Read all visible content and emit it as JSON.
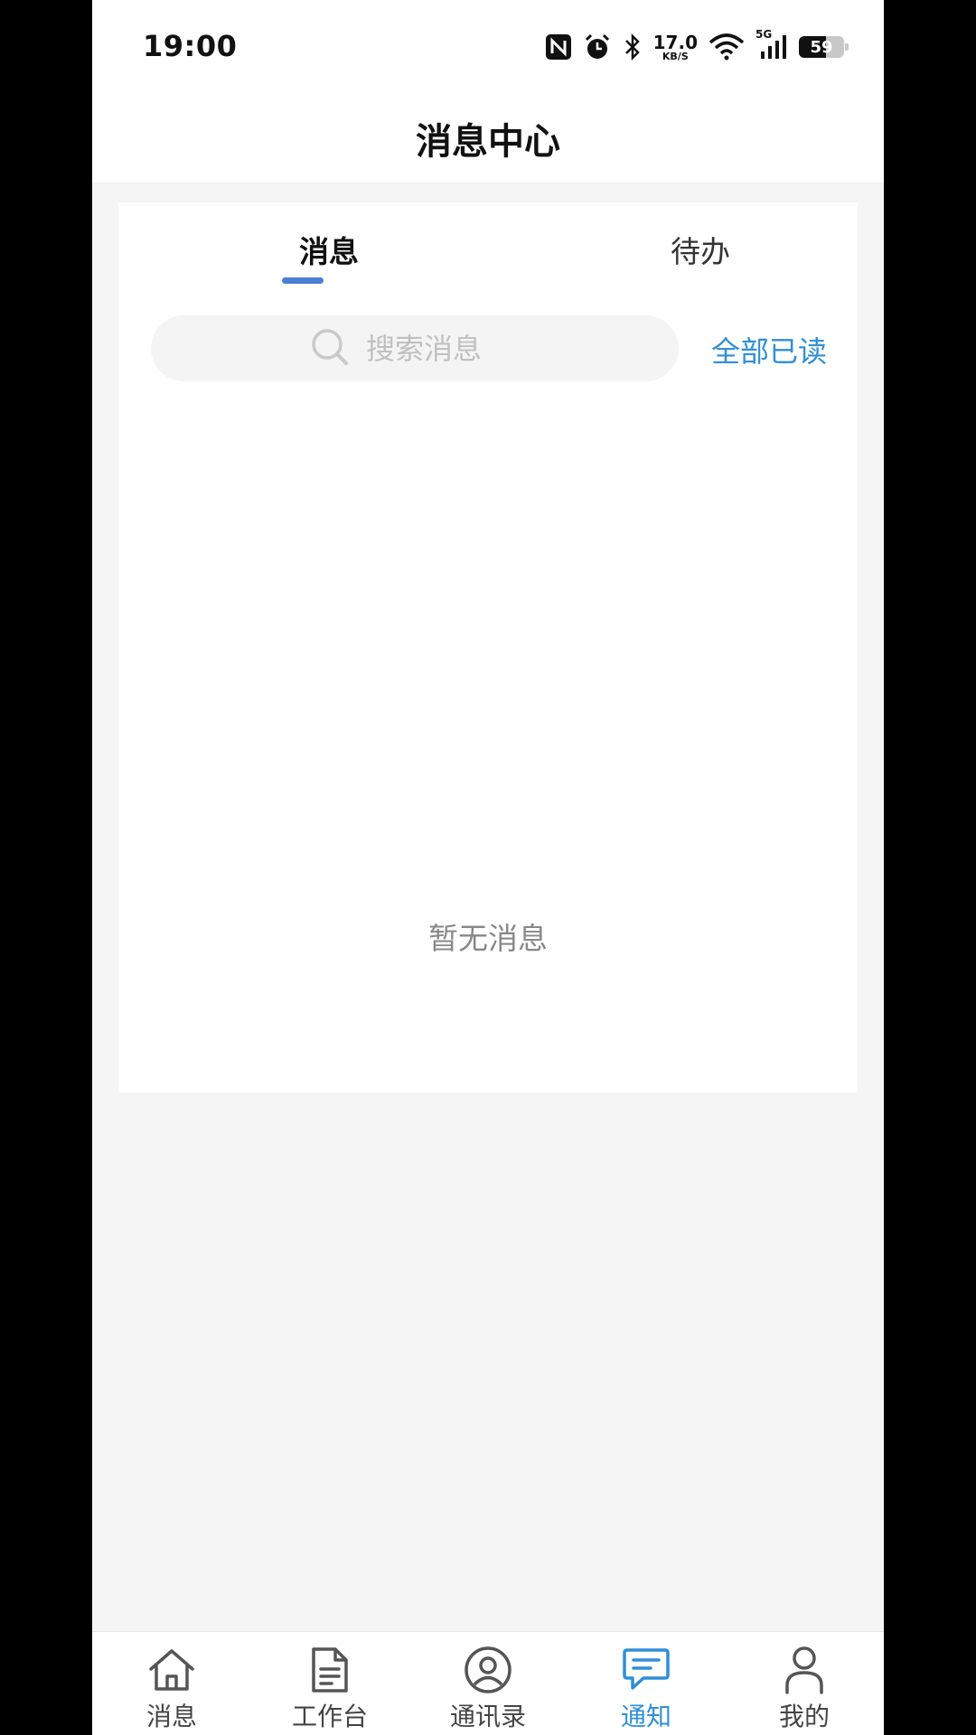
{
  "status_bar": {
    "time": "19:00",
    "net_speed_value": "17.0",
    "net_speed_unit": "KB/S",
    "network_type": "5G",
    "battery_level": "59",
    "icons": [
      "nfc-icon",
      "alarm-icon",
      "bluetooth-icon",
      "wifi-icon",
      "signal-icon",
      "battery-icon"
    ]
  },
  "header": {
    "title": "消息中心"
  },
  "tabs": [
    {
      "label": "消息",
      "active": true
    },
    {
      "label": "待办",
      "active": false
    }
  ],
  "search": {
    "placeholder": "搜索消息",
    "value": ""
  },
  "actions": {
    "mark_all_read": "全部已读"
  },
  "empty_state": {
    "text": "暂无消息"
  },
  "colors": {
    "accent": "#2f8fd8",
    "tab_indicator": "#4a7fd6",
    "background": "#f5f5f5"
  },
  "bottom_nav": [
    {
      "label": "消息",
      "icon": "home-icon",
      "active": false
    },
    {
      "label": "工作台",
      "icon": "document-icon",
      "active": false
    },
    {
      "label": "通讯录",
      "icon": "contacts-icon",
      "active": false
    },
    {
      "label": "通知",
      "icon": "chat-bubble-icon",
      "active": true
    },
    {
      "label": "我的",
      "icon": "person-icon",
      "active": false
    }
  ]
}
